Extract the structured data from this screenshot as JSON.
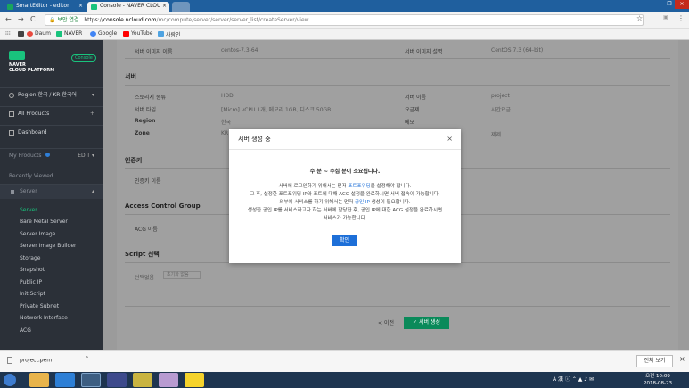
{
  "browser": {
    "tabs": [
      {
        "title": "SmartEditor - editor",
        "color": "#19a55e"
      },
      {
        "title": "Console - NAVER CLOU",
        "color": "#19c37d"
      }
    ],
    "nav": {
      "back": "←",
      "forward": "→",
      "reload": "C"
    },
    "url": {
      "security": "보안 연결",
      "scheme": "https://",
      "domain": "console.ncloud.com",
      "path": "/mc/compute/server/server/server_list/createServer/view"
    },
    "bookmarks": [
      {
        "label": "",
        "color": "#444"
      },
      {
        "label": "Daum",
        "color": "#e94a3f"
      },
      {
        "label": "NAVER",
        "color": "#19c37d"
      },
      {
        "label": "Google",
        "color": "#4285f4"
      },
      {
        "label": "YouTube",
        "color": "#ff0000"
      },
      {
        "label": "사람인",
        "color": "#4fa3e1"
      }
    ]
  },
  "sidebar": {
    "logo_text": "NAVER\nCLOUD PLATFORM",
    "console_badge": "Console",
    "region": "Region 한국 / KR 한국어",
    "all_products": "All Products",
    "dashboard": "Dashboard",
    "my_products": "My Products",
    "edit": "EDIT",
    "recently_viewed": "Recently Viewed",
    "server": "Server",
    "sub_items": [
      "Server",
      "Bare Metal Server",
      "Server Image",
      "Server Image Builder",
      "Storage",
      "Snapshot",
      "Public IP",
      "Init Script",
      "Private Subnet",
      "Network Interface",
      "ACG"
    ],
    "selected": "Server"
  },
  "main": {
    "rows1": {
      "server_image_name_label": "서버 이미지 이름",
      "server_image_name": "centos-7.3-64",
      "server_image_desc_label": "서버 이미지 설명",
      "server_image_desc": "CentOS 7.3 (64-bit)"
    },
    "server_section": "서버",
    "server_rows": [
      {
        "l": "스토리지 종류",
        "v": "HDD",
        "l2": "서버 이름",
        "v2": "project"
      },
      {
        "l": "서버 타입",
        "v": "[Micro] vCPU 1개, 메모리 1GB, 디스크 50GB",
        "l2": "요금제",
        "v2": "시간요금"
      },
      {
        "l": "Region",
        "v": "한국",
        "l2": "메모",
        "v2": ""
      },
      {
        "l": "Zone",
        "v": "KR",
        "l2": "",
        "v2": "제제"
      }
    ],
    "auth_section": "인증키",
    "auth_label": "인증키 이름",
    "acg_section": "Access Control Group",
    "acg_label": "ACG 이름",
    "script_section": "Script 선택",
    "script_label": "선택없음",
    "script_select": "초기화 없음",
    "prev_btn": "< 이전",
    "create_btn": "✓ 서버 생성"
  },
  "modal": {
    "title": "서버 생성 중",
    "close": "×",
    "headline": "수 분 ~ 수십 분이 소요됩니다.",
    "line1_a": "서버에 로그인하기 위해서는 먼저 ",
    "line1_link": "포트포워딩",
    "line1_b": "을 설정해야 합니다.",
    "line2": "그 후, 설정한 포트포워딩 IP와 포트에 대해 ACG 설정을 완료하시면 서버 접속이 가능합니다.",
    "line3_a": "외부에 서비스를 하기 위해서는 먼저 ",
    "line3_link": "공인 IP",
    "line3_b": " 생성이 필요합니다.",
    "line4": "생성한 공인 IP를 서비스하고자 하는 서버에 할당한 후, 공인 IP에 대한 ACG 설정을 완료하시면",
    "line5": "서비스가 가능합니다.",
    "ok": "확인"
  },
  "downloads": {
    "file": "project.pem",
    "show_all": "전체 보기"
  },
  "taskbar": {
    "ime": "A 漢",
    "time": "오전 10:09",
    "date": "2018-08-23"
  }
}
